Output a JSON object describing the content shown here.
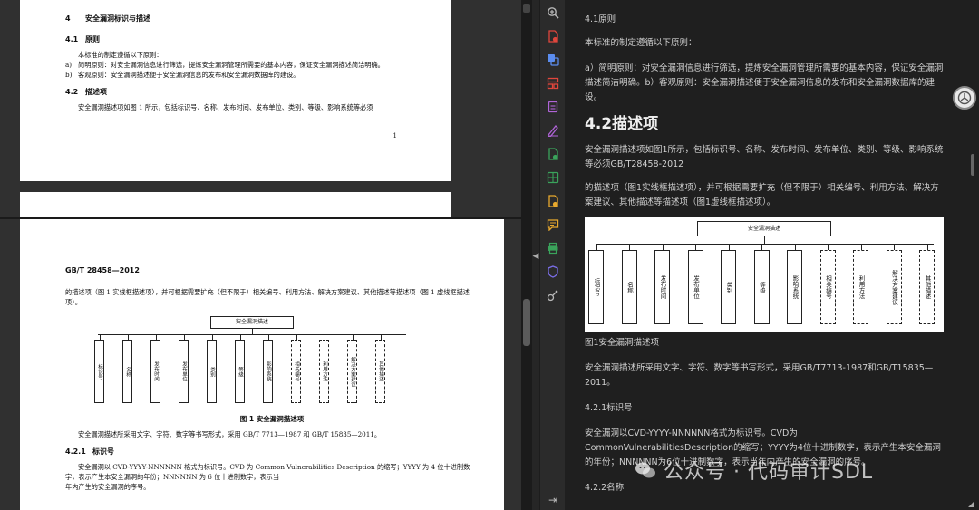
{
  "left": {
    "page1": {
      "sec4": {
        "num": "4",
        "title": "安全漏洞标识与描述"
      },
      "sec41": {
        "num": "4.1",
        "title": "原则"
      },
      "p_intro": "本标准的制定遵循以下原则：",
      "items": [
        {
          "mark": "a)",
          "text": "简明原则：对安全漏洞信息进行筛选，提炼安全漏洞管理所需要的基本内容，保证安全漏洞描述简洁明确。"
        },
        {
          "mark": "b)",
          "text": "客观原则：安全漏洞描述便于安全漏洞信息的发布和安全漏洞数据库的建设。"
        }
      ],
      "sec42": {
        "num": "4.2",
        "title": "描述项"
      },
      "p_desc": "安全漏洞描述项如图 1 所示，包括标识号、名称、发布时间、发布单位、类别、等级、影响系统等必须",
      "page_number": "1"
    },
    "page2": {
      "header": "GB/T 28458—2012",
      "p_cont": "的描述项（图 1 实线框描述项），并可根据需要扩充（但不限于）相关编号、利用方法、解决方案建议、其他描述等描述项（图 1 虚线框描述项）。",
      "diagram_top": "安全漏洞描述",
      "diagram_items": [
        {
          "label": "标识号",
          "dashed": false
        },
        {
          "label": "名称",
          "dashed": false
        },
        {
          "label": "发布时间",
          "dashed": false
        },
        {
          "label": "发布单位",
          "dashed": false
        },
        {
          "label": "类别",
          "dashed": false
        },
        {
          "label": "等级",
          "dashed": false
        },
        {
          "label": "影响系统",
          "dashed": false
        },
        {
          "label": "相关编号",
          "dashed": true
        },
        {
          "label": "利用方法",
          "dashed": true
        },
        {
          "label": "解决方案建议",
          "dashed": true
        },
        {
          "label": "其他描述",
          "dashed": true
        }
      ],
      "figure_caption": "图 1   安全漏洞描述项",
      "p_fonts": "安全漏洞描述所采用文字、字符、数字等书写形式，采用 GB/T 7713—1987 和 GB/T 15835—2011。",
      "sec421": {
        "num": "4.2.1",
        "title": "标识号"
      },
      "p_id": "安全漏洞以 CVD-YYYY-NNNNNN 格式为标识号。CVD 为 Common Vulnerabilities Description 的缩写；YYYY 为 4 位十进制数字，表示产生本安全漏洞的年份；NNNNNN 为 6 位十进制数字，表示当",
      "p_id_tail": "年内产生的安全漏洞的序号。"
    }
  },
  "toolbar": {
    "items": [
      {
        "name": "zoom-in-icon",
        "color": "#b8b8b8"
      },
      {
        "name": "pdf-convert-icon",
        "color": "#e0463c"
      },
      {
        "name": "translate-icon",
        "color": "#5b8def"
      },
      {
        "name": "layout-icon",
        "color": "#e0463c"
      },
      {
        "name": "doc-icon",
        "color": "#b064d8"
      },
      {
        "name": "sign-icon",
        "color": "#b064d8"
      },
      {
        "name": "add-doc-icon",
        "color": "#3aa35b"
      },
      {
        "name": "excel-icon",
        "color": "#3aa35b"
      },
      {
        "name": "ppt-icon",
        "color": "#e8a92e"
      },
      {
        "name": "comment-icon",
        "color": "#e8a92e"
      },
      {
        "name": "print-icon",
        "color": "#3aa35b"
      },
      {
        "name": "shield-icon",
        "color": "#7b6ee8"
      },
      {
        "name": "tools-icon",
        "color": "#b8b8b8"
      }
    ],
    "bottom": {
      "name": "expand-icon",
      "glyph": "⇥"
    }
  },
  "right": {
    "h41": "4.1原则",
    "p_intro": "本标准的制定遵循以下原则：",
    "p_ab": "a）简明原则：对安全漏洞信息进行筛选，提炼安全漏洞管理所需要的基本内容，保证安全漏洞描述简洁明确。b）客观原则：安全漏洞描述便于安全漏洞信息的发布和安全漏洞数据库的建设。",
    "h42": "4.2描述项",
    "p_desc": "安全漏洞描述项如图1所示，包括标识号、名称、发布时间、发布单位、类别、等级、影响系统等必须GB/T28458-2012",
    "p_cont": "的描述项（图1实线框描述项），并可根据需要扩充（但不限于）相关编号、利用方法、解决方案建议、其他描述等描述项（图1虚线框描述项）。",
    "diagram_top": "安全漏洞描述",
    "figure_caption": "图1安全漏洞描述项",
    "p_fonts": "安全漏洞描述所采用文字、字符、数字等书写形式，采用GB/T7713-1987和GB/T15835—2011。",
    "h421": "4.2.1标识号",
    "p_id": "安全漏洞以CVD-YYYY-NNNNNN格式为标识号。CVD为CommonVulnerabilitiesDescription的缩写；YYYY为4位十进制数字，表示产生本安全漏洞的年份；NNNNNN为6位十进制数字，表示当年内产生的安全漏洞的序号。",
    "h422": "4.2.2名称"
  },
  "watermark": {
    "text": "公众号 · 代码审计SDL",
    "icon": "wechat-icon"
  }
}
